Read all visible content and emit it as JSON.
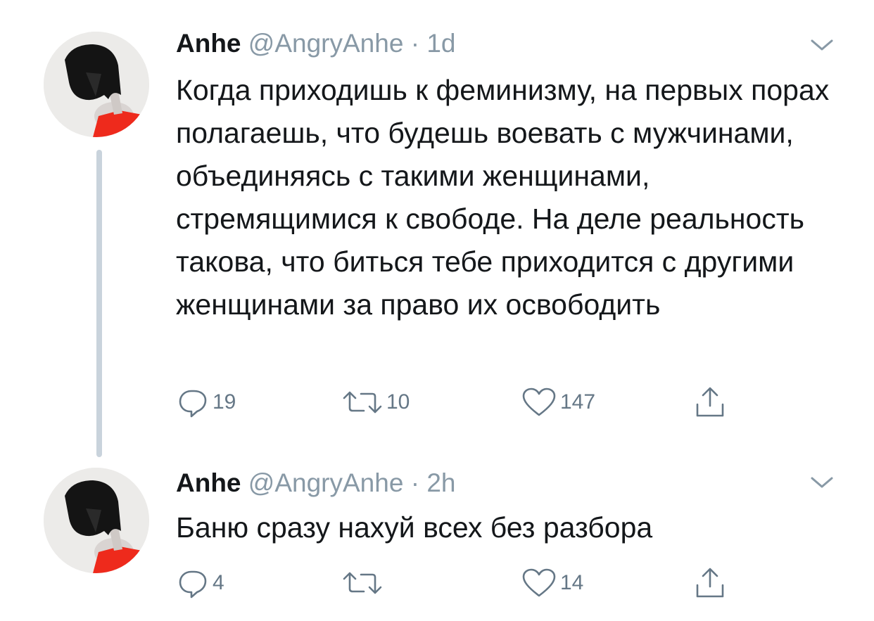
{
  "tweets": [
    {
      "author_name": "Anhe",
      "handle": "@AngryAnhe",
      "separator": "·",
      "time": "1d",
      "text": "Когда приходишь к феминизму, на первых порах полагаешь, что будешь воевать с мужчинами, объединяясь с такими женщинами, стремящимися к свободе. На деле реальность такова, что биться тебе приходится с другими женщинами за право их освободить",
      "reply_count": "19",
      "retweet_count": "10",
      "like_count": "147"
    },
    {
      "author_name": "Anhe",
      "handle": "@AngryAnhe",
      "separator": "·",
      "time": "2h",
      "text": "Баню сразу нахуй всех без разбора",
      "reply_count": "4",
      "retweet_count": "",
      "like_count": "14"
    }
  ],
  "icons": {
    "reply": "reply-icon",
    "retweet": "retweet-icon",
    "like": "heart-icon",
    "share": "share-icon",
    "menu": "chevron-down-icon"
  },
  "colors": {
    "text": "#14171a",
    "meta": "#8899a6",
    "icon": "#657786",
    "thread_line": "#c9d3dc",
    "avatar_shirt": "#ee2a1c"
  }
}
